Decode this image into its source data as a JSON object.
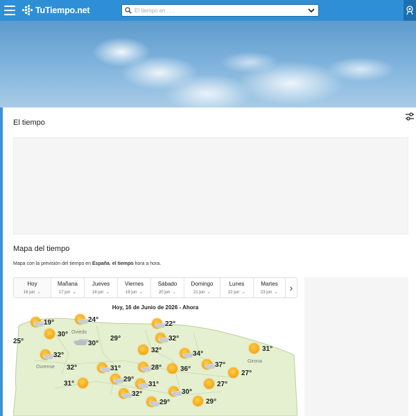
{
  "header": {
    "logo_text": "TuTiempo.net",
    "search_placeholder": "El tiempo en . . ."
  },
  "main": {
    "title": "El tiempo",
    "map_heading": "Mapa del tiempo",
    "map_desc_prefix": "Mapa con la previsión del tiempo en ",
    "map_desc_country": "España",
    "map_desc_middle": ", ",
    "map_desc_bold": "el tiempo",
    "map_desc_suffix": " hora a hora.",
    "map_title": "Hoy, 16 de Junio de 2026 - Ahora"
  },
  "days": [
    {
      "name": "Hoy",
      "date": "16 jun"
    },
    {
      "name": "Mañana",
      "date": "17 jun"
    },
    {
      "name": "Jueves",
      "date": "18 jun"
    },
    {
      "name": "Viernes",
      "date": "19 jun"
    },
    {
      "name": "Sábado",
      "date": "20 jun"
    },
    {
      "name": "Domingo",
      "date": "21 jun"
    },
    {
      "name": "Lunes",
      "date": "22 jun"
    },
    {
      "name": "Martes",
      "date": "23 jun"
    }
  ],
  "cities": [
    "Oviedo",
    "Ourense",
    "Girona"
  ],
  "markers": [
    {
      "temp": "19°",
      "icon": "sun-cloud"
    },
    {
      "temp": "24°",
      "icon": "sun-cloud"
    },
    {
      "temp": "22°",
      "icon": "sun-cloud"
    },
    {
      "temp": "30°",
      "icon": "sun"
    },
    {
      "temp": "25°",
      "icon": "sun"
    },
    {
      "temp": "30°",
      "icon": "cloud"
    },
    {
      "temp": "29°",
      "icon": "sun-cloud"
    },
    {
      "temp": "32°",
      "icon": "sun-cloud"
    },
    {
      "temp": "32°",
      "icon": "sun-cloud"
    },
    {
      "temp": "32°",
      "icon": "sun"
    },
    {
      "temp": "34°",
      "icon": "sun-cloud"
    },
    {
      "temp": "31°",
      "icon": "sun"
    },
    {
      "temp": "32°",
      "icon": "sun-cloud"
    },
    {
      "temp": "31°",
      "icon": "sun-cloud"
    },
    {
      "temp": "28°",
      "icon": "sun-cloud"
    },
    {
      "temp": "36°",
      "icon": "sun"
    },
    {
      "temp": "37°",
      "icon": "sun-cloud"
    },
    {
      "temp": "27°",
      "icon": "sun"
    },
    {
      "temp": "29°",
      "icon": "sun-cloud"
    },
    {
      "temp": "31°",
      "icon": "sun-cloud"
    },
    {
      "temp": "31°",
      "icon": "sun-cloud"
    },
    {
      "temp": "27°",
      "icon": "sun"
    },
    {
      "temp": "32°",
      "icon": "sun-cloud"
    },
    {
      "temp": "30°",
      "icon": "sun-cloud"
    },
    {
      "temp": "29°",
      "icon": "sun-cloud"
    },
    {
      "temp": "29°",
      "icon": "sun"
    }
  ],
  "colors": {
    "topbar": "#2f8fd6",
    "land": "#e4f0cf",
    "sea": "#ffffff"
  }
}
